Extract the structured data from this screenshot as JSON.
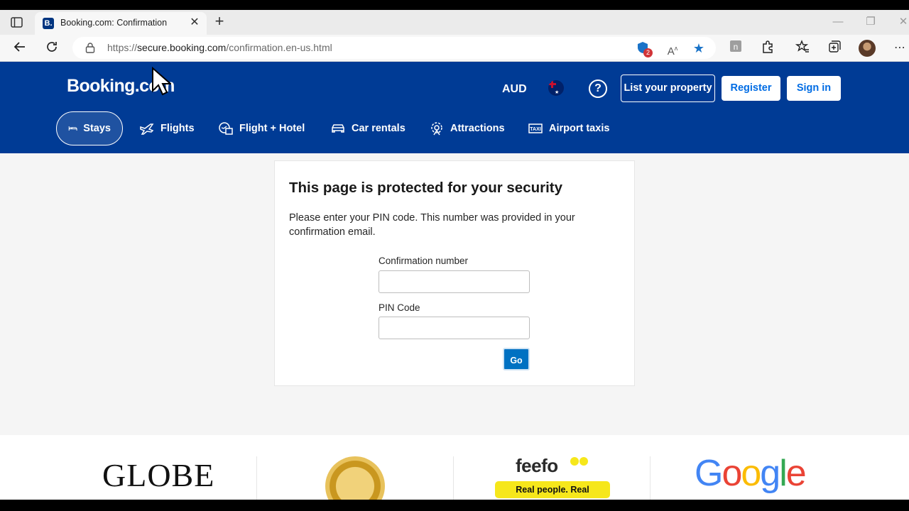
{
  "browser": {
    "tab_title": "Booking.com: Confirmation",
    "tab_favicon": "B.",
    "url_prefix": "https://",
    "url_host": "secure.booking.com",
    "url_path": "/confirmation.en-us.html",
    "extension_badge": "2"
  },
  "header": {
    "logo": "Booking.com",
    "currency": "AUD",
    "list_property": "List your property",
    "register": "Register",
    "sign_in": "Sign in",
    "nav": [
      {
        "label": "Stays",
        "icon": "bed-icon"
      },
      {
        "label": "Flights",
        "icon": "plane-icon"
      },
      {
        "label": "Flight + Hotel",
        "icon": "flight-hotel-icon"
      },
      {
        "label": "Car rentals",
        "icon": "car-icon"
      },
      {
        "label": "Attractions",
        "icon": "attractions-icon"
      },
      {
        "label": "Airport taxis",
        "icon": "taxi-icon"
      }
    ]
  },
  "form": {
    "title": "This page is protected for your security",
    "description": "Please enter your PIN code. This number was provided in your confirmation email.",
    "confirmation_label": "Confirmation number",
    "confirmation_value": "",
    "pin_label": "PIN Code",
    "pin_value": "",
    "submit": "Go"
  },
  "footer": {
    "globe": "GLOBE",
    "feefo": "feefo",
    "feefo_tagline": "Real people. Real opinions.",
    "google": [
      "G",
      "o",
      "o",
      "g",
      "l",
      "e"
    ]
  },
  "colors": {
    "brand": "#003b95",
    "button": "#0071c2",
    "link": "#006ce4"
  }
}
